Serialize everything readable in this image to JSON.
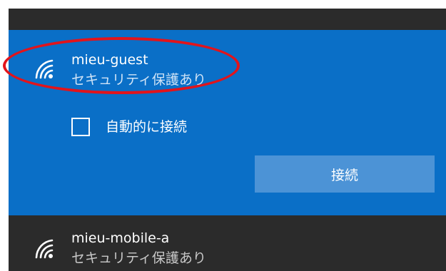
{
  "networks": [
    {
      "name": "mieu-guest",
      "status": "セキュリティ保護あり",
      "icon": "wifi-icon",
      "selected": true,
      "auto_connect_label": "自動的に接続",
      "auto_connect_checked": false,
      "connect_label": "接続"
    },
    {
      "name": "mieu-mobile-a",
      "status": "セキュリティ保護あり",
      "icon": "wifi-icon",
      "selected": false
    }
  ],
  "colors": {
    "panel_bg": "#2b2b2b",
    "selected_bg": "#0a6fc7",
    "button_bg": "#4c93d6",
    "annotation_red": "#e2141b"
  }
}
